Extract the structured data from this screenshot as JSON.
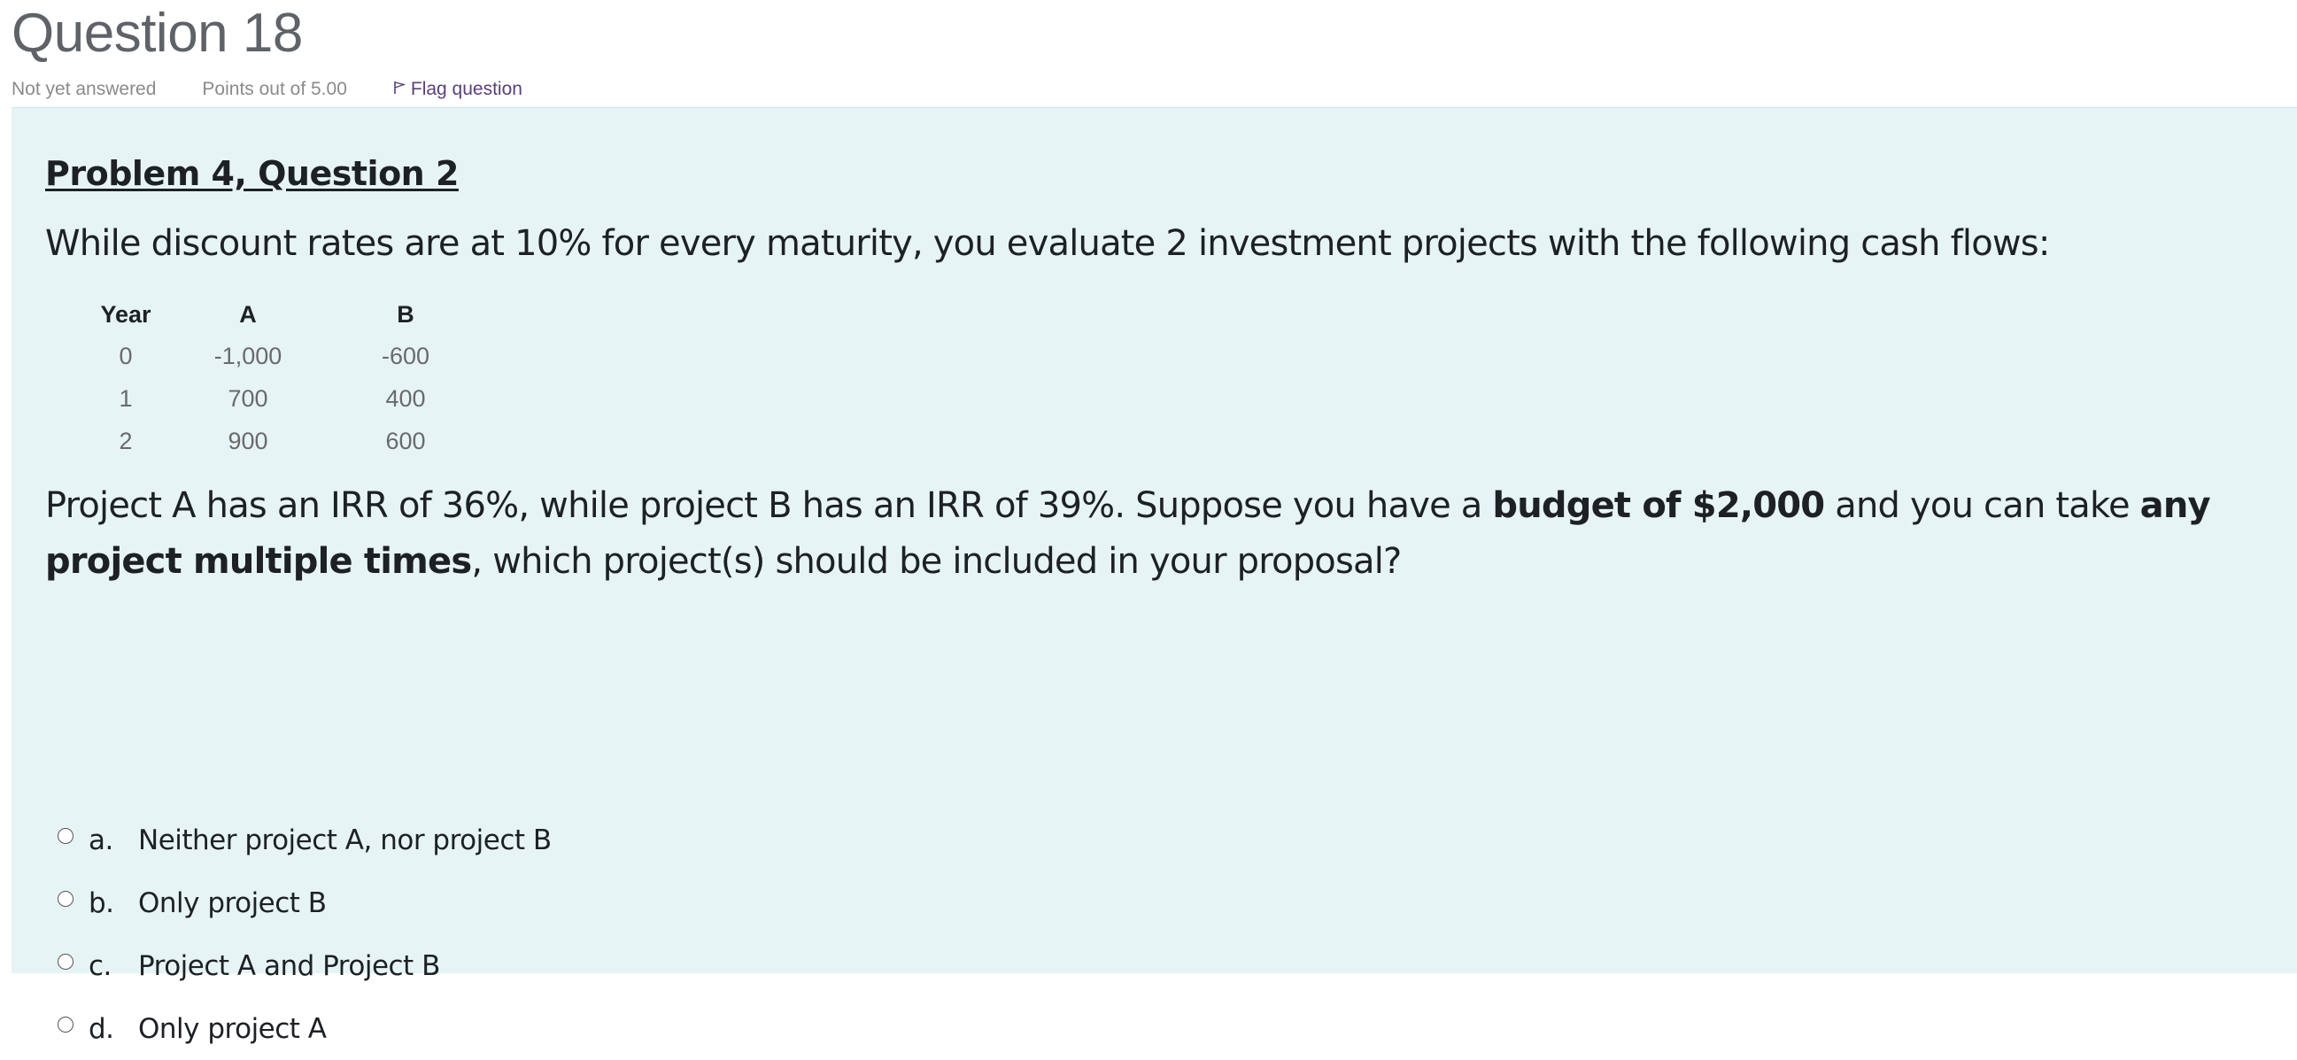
{
  "question": {
    "title": "Question 18",
    "status": "Not yet answered",
    "points": "Points out of 5.00",
    "flag_label": "Flag question"
  },
  "problem": {
    "heading": "Problem 4, Question 2",
    "intro": "While discount rates are at 10% for every maturity, you evaluate 2 investment projects with the following cash flows:",
    "table": {
      "headers": [
        "Year",
        "A",
        "B"
      ],
      "rows": [
        [
          "0",
          "-1,000",
          "-600"
        ],
        [
          "1",
          "700",
          "400"
        ],
        [
          "2",
          "900",
          "600"
        ]
      ]
    },
    "text_1": "Project A has an IRR of 36%, while project B has an IRR of 39%. Suppose you have a ",
    "bold_1": "budget of $2,000",
    "text_2": " and you can take ",
    "bold_2": "any project multiple times",
    "text_3": ", which project(s) should be included in your proposal?"
  },
  "answers": [
    {
      "letter": "a.",
      "text": "Neither project A, nor project B"
    },
    {
      "letter": "b.",
      "text": "Only project B"
    },
    {
      "letter": "c.",
      "text": "Project A and Project B"
    },
    {
      "letter": "d.",
      "text": "Only project A"
    }
  ]
}
